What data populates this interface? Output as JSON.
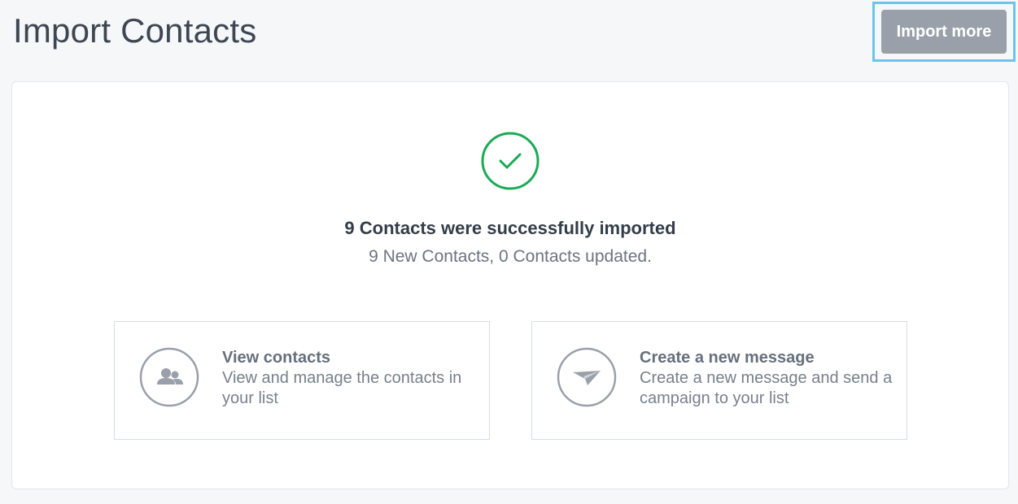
{
  "header": {
    "title": "Import Contacts",
    "import_more_label": "Import more"
  },
  "result": {
    "title": "9 Contacts were successfully imported",
    "subtitle": "9 New Contacts, 0 Contacts updated."
  },
  "actions": [
    {
      "title": "View contacts",
      "description": "View and manage the contacts in your list",
      "icon": "users-icon"
    },
    {
      "title": "Create a new message",
      "description": "Create a new message and send a campaign to your list",
      "icon": "paper-plane-icon"
    }
  ],
  "colors": {
    "success": "#1aaa55",
    "accent_outline": "#6cc4e8",
    "button_bg": "#9aa0a9",
    "icon_gray": "#9aa0a9"
  }
}
